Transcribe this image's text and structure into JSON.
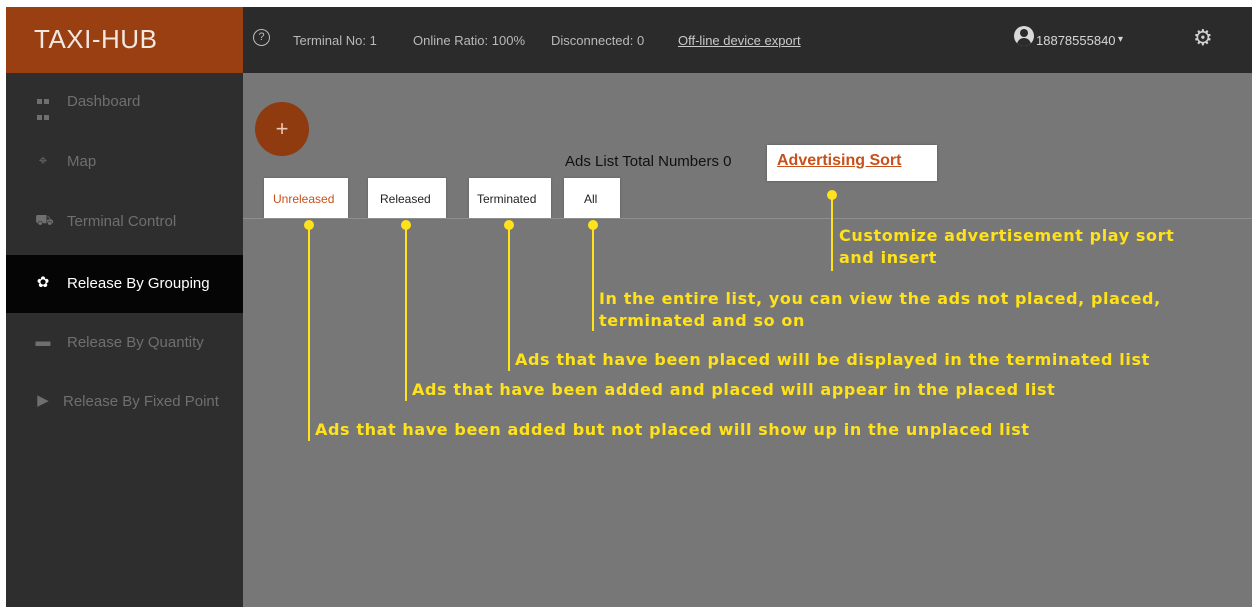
{
  "header": {
    "logo": "TAXI-HUB",
    "help_icon": "?",
    "terminal_no": "Terminal No: 1",
    "online_ratio": "Online Ratio: 100%",
    "disconnected": "Disconnected: 0",
    "export_link": "Off-line device export",
    "user": "18878555840",
    "caret": "▾",
    "gear": "⚙"
  },
  "sidebar": {
    "items": [
      {
        "label": "Dashboard",
        "icon": "dashboard-icon"
      },
      {
        "label": "Map",
        "icon": "map-icon"
      },
      {
        "label": "Terminal Control",
        "icon": "car-icon"
      },
      {
        "label": "Release By Grouping",
        "icon": "group-icon",
        "active": true
      },
      {
        "label": "Release By Quantity",
        "icon": "quantity-icon"
      },
      {
        "label": "Release By Fixed Point",
        "icon": "play-icon"
      }
    ]
  },
  "main": {
    "add_button": "+",
    "list_total": "Ads List Total Numbers 0",
    "sort_button": "Advertising Sort",
    "tabs": [
      {
        "label": "Unreleased",
        "selected": true
      },
      {
        "label": "Released"
      },
      {
        "label": "Terminated"
      },
      {
        "label": "All"
      }
    ]
  },
  "annotations": {
    "sort": [
      "Customize advertisement play sort",
      "and insert"
    ],
    "all": [
      "In the entire list, you can view the ads not placed, placed,",
      "terminated and so on"
    ],
    "terminated": "Ads that have been placed will be displayed in the terminated list",
    "released": "Ads that have been added and placed will appear in the placed list",
    "unreleased": "Ads that have been added but not placed will show up in the unplaced list"
  },
  "colors": {
    "brand": "#9a3f12",
    "accent": "#c8501a",
    "annotation": "#ffe21a"
  }
}
